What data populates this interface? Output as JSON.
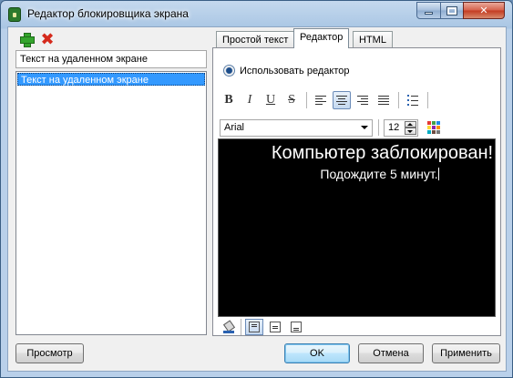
{
  "window": {
    "title": "Редактор блокировщика экрана"
  },
  "left_pane": {
    "name_value": "Текст на удаленном экране",
    "list_items": [
      "Текст на удаленном экране"
    ]
  },
  "tabs": [
    {
      "label": "Простой текст",
      "active": false
    },
    {
      "label": "Редактор",
      "active": true
    },
    {
      "label": "HTML",
      "active": false
    }
  ],
  "editor_tab": {
    "use_editor_label": "Использовать редактор",
    "font_name": "Arial",
    "font_size": "12",
    "content_line1": "Компьютер заблокирован!",
    "content_line2": "Подождите 5 минут."
  },
  "format_buttons": {
    "bold": "B",
    "italic": "I",
    "underline": "U",
    "strike": "S"
  },
  "buttons": {
    "preview": "Просмотр",
    "ok": "OK",
    "cancel": "Отмена",
    "apply": "Применить"
  },
  "palette_colors": [
    "#e53935",
    "#43a047",
    "#1e88e5",
    "#fdd835",
    "#8e24aa",
    "#fb8c00",
    "#00acc1",
    "#6d4c41",
    "#757575"
  ]
}
